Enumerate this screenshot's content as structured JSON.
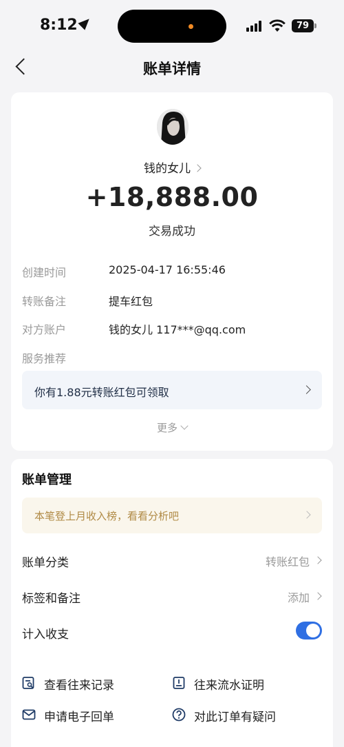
{
  "status": {
    "time": "8:12",
    "battery": "79"
  },
  "nav": {
    "title": "账单详情"
  },
  "payee": {
    "name": "钱的女儿",
    "amount": "+18,888.00",
    "status": "交易成功"
  },
  "details": [
    {
      "label": "创建时间",
      "value": "2025-04-17 16:55:46"
    },
    {
      "label": "转账备注",
      "value": "提车红包"
    },
    {
      "label": "对方账户",
      "value": "钱的女儿 117***@qq.com"
    },
    {
      "label": "服务推荐",
      "value": ""
    }
  ],
  "promo": {
    "text": "你有1.88元转账红包可领取"
  },
  "more": {
    "label": "更多"
  },
  "management": {
    "title": "账单管理",
    "tip": "本笔登上月收入榜，看看分析吧",
    "category": {
      "label": "账单分类",
      "value": "转账红包"
    },
    "tags": {
      "label": "标签和备注",
      "value": "添加"
    },
    "income": {
      "label": "计入收支",
      "enabled": true
    }
  },
  "actions": [
    {
      "label": "查看往来记录",
      "icon": "record-search-icon"
    },
    {
      "label": "往来流水证明",
      "icon": "statement-doc-icon"
    },
    {
      "label": "申请电子回单",
      "icon": "mail-icon"
    },
    {
      "label": "对此订单有疑问",
      "icon": "question-icon"
    }
  ],
  "colors": {
    "accent": "#2f6fe3",
    "tip_text": "#b08a45",
    "tip_bg": "#faf6ec"
  }
}
